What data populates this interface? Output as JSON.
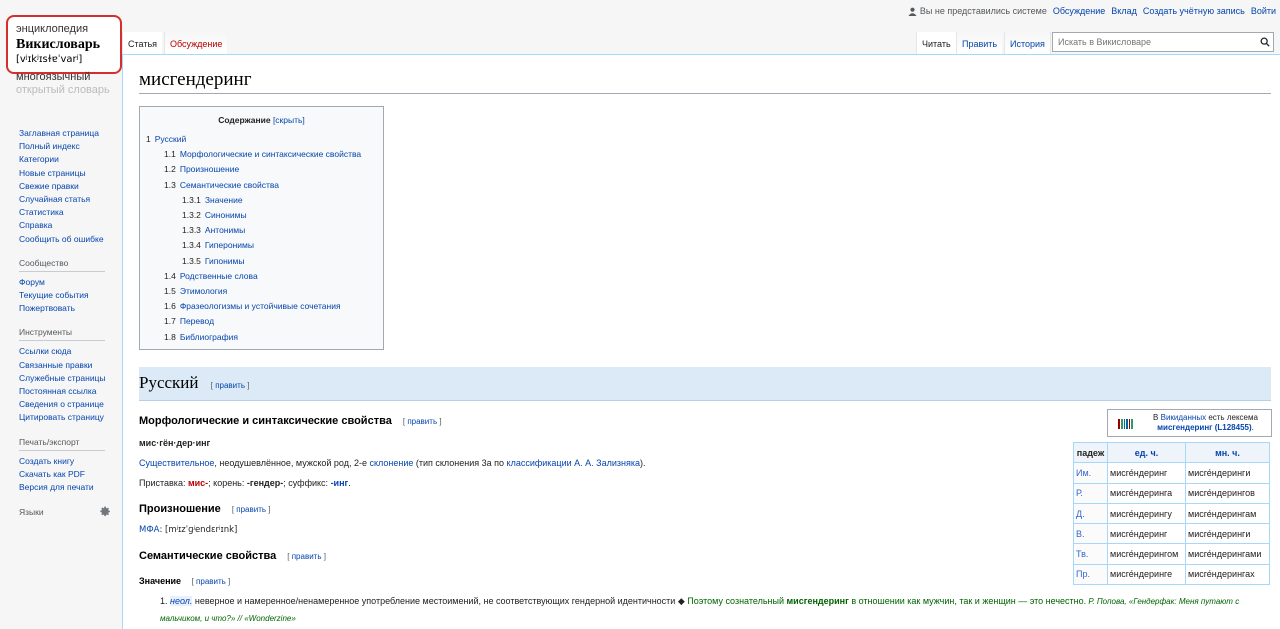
{
  "personal": {
    "not_logged_in": "Вы не представились системе",
    "discussion": "Обсуждение",
    "contributions": "Вклад",
    "create_account": "Создать учётную запись",
    "login": "Войти"
  },
  "logo": {
    "encyclopedia": "энциклопедия",
    "title": "Викисловарь",
    "ipa": "[vʲɪkʲɪsɫɐˈvarʲ]",
    "subtitle1": "многоязычный",
    "subtitle2": "открытый словарь"
  },
  "sidebar": {
    "nav": [
      "Заглавная страница",
      "Полный индекс",
      "Категории",
      "Новые страницы",
      "Свежие правки",
      "Случайная статья",
      "Статистика",
      "Справка",
      "Сообщить об ошибке"
    ],
    "community_heading": "Сообщество",
    "community": [
      "Форум",
      "Текущие события",
      "Пожертвовать"
    ],
    "tools_heading": "Инструменты",
    "tools": [
      "Ссылки сюда",
      "Связанные правки",
      "Служебные страницы",
      "Постоянная ссылка",
      "Сведения о странице",
      "Цитировать страницу"
    ],
    "print_heading": "Печать/экспорт",
    "print": [
      "Создать книгу",
      "Скачать как PDF",
      "Версия для печати"
    ],
    "languages_heading": "Языки"
  },
  "tabs": {
    "article": "Статья",
    "talk": "Обсуждение",
    "read": "Читать",
    "edit": "Править",
    "history": "История"
  },
  "search": {
    "placeholder": "Искать в Викисловаре"
  },
  "page": {
    "title": "мисгендеринг"
  },
  "toc": {
    "title": "Содержание",
    "hide": "[скрыть]",
    "items": [
      {
        "n": "1",
        "t": "Русский"
      },
      {
        "n": "1.1",
        "t": "Морфологические и синтаксические свойства"
      },
      {
        "n": "1.2",
        "t": "Произношение"
      },
      {
        "n": "1.3",
        "t": "Семантические свойства"
      },
      {
        "n": "1.3.1",
        "t": "Значение"
      },
      {
        "n": "1.3.2",
        "t": "Синонимы"
      },
      {
        "n": "1.3.3",
        "t": "Антонимы"
      },
      {
        "n": "1.3.4",
        "t": "Гиперонимы"
      },
      {
        "n": "1.3.5",
        "t": "Гипонимы"
      },
      {
        "n": "1.4",
        "t": "Родственные слова"
      },
      {
        "n": "1.5",
        "t": "Этимология"
      },
      {
        "n": "1.6",
        "t": "Фразеологизмы и устойчивые сочетания"
      },
      {
        "n": "1.7",
        "t": "Перевод"
      },
      {
        "n": "1.8",
        "t": "Библиография"
      }
    ]
  },
  "edit_link": {
    "open": "[ ",
    "label": "править",
    "close": " ]"
  },
  "russian": {
    "heading": "Русский",
    "morph_heading": "Морфологические и синтаксические свойства",
    "syllables": "мис·гён·дер·инг",
    "pos_link": "Существительное",
    "pos_rest": ", неодушевлённое, мужской род, 2-е ",
    "decl_link": "склонение",
    "decl_rest1": " (тип склонения 3a по ",
    "class_link": "классификации А. А. Зализняка",
    "decl_rest2": ").",
    "prefix_label": "Приставка: ",
    "prefix": "мис-",
    "root_label": "; корень: ",
    "root": "-гендер-",
    "suffix_label": "; суффикс: ",
    "suffix": "-инг",
    "end": ".",
    "pron_heading": "Произношение",
    "ipa_label": "МФА",
    "ipa": ": [mʲɪzˈɡʲendɛrʲɪnk]",
    "sem_heading": "Семантические свойства",
    "meaning_heading": "Значение",
    "def_num": "1.",
    "def_label": "неол.",
    "def_text": " неверное и намеренное/ненамеренное употребление местоимений, не соответствующих гендерной идентичности ◆ ",
    "ex_part1": "Поэтому сознательный ",
    "ex_bold": "мисгендеринг",
    "ex_part2": " в отношении как мужчин, так и женщин — это нечестно.",
    "ex_source": " Р. Попова, «Гендерфак: Меня путают с мальчиком, и что?» // «Wonderzine»"
  },
  "wikidata": {
    "prefix": "В ",
    "link": "Викиданных",
    "mid": " есть лексема",
    "lexeme": "мисгендеринг (L128455)",
    "end": "."
  },
  "declension": {
    "headers": [
      "падеж",
      "ед. ч.",
      "мн. ч."
    ],
    "rows": [
      [
        "Им.",
        "мисге́ндеринг",
        "мисге́ндеринги"
      ],
      [
        "Р.",
        "мисге́ндеринга",
        "мисге́ндерингов"
      ],
      [
        "Д.",
        "мисге́ндерингу",
        "мисге́ндерингам"
      ],
      [
        "В.",
        "мисге́ндеринг",
        "мисге́ндеринги"
      ],
      [
        "Тв.",
        "мисге́ндерингом",
        "мисге́ндерингами"
      ],
      [
        "Пр.",
        "мисге́ндеринге",
        "мисге́ндерингах"
      ]
    ]
  }
}
